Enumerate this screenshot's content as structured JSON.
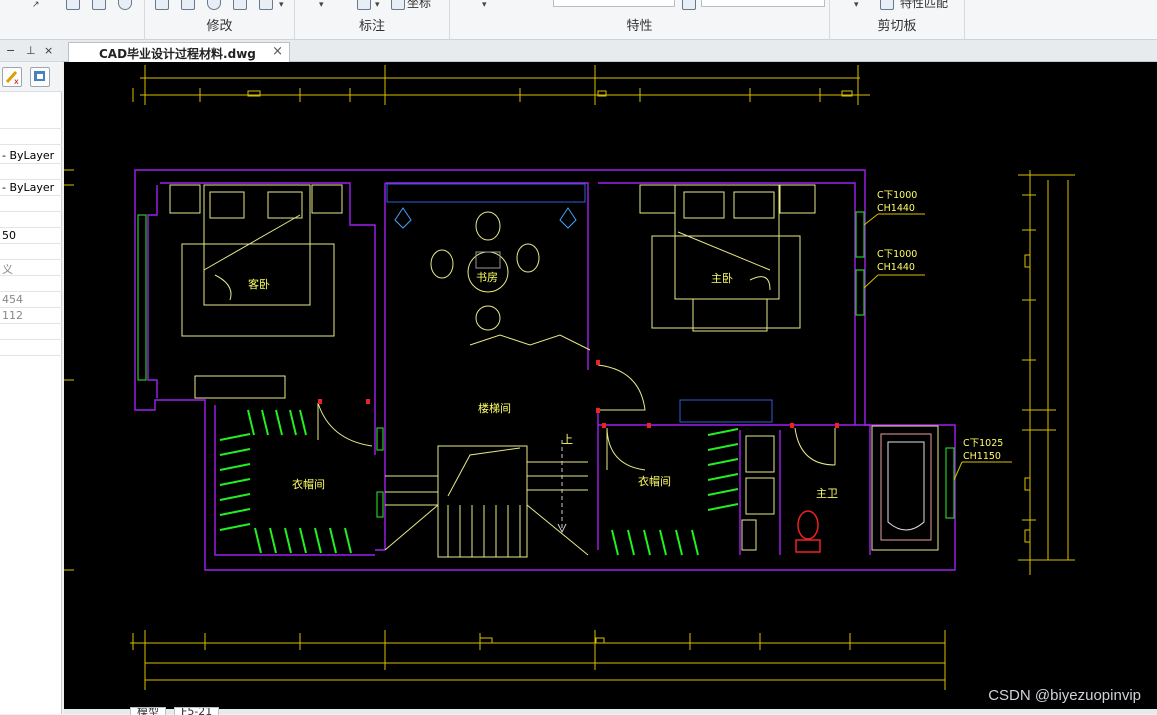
{
  "ribbon": {
    "groups": [
      {
        "label": "修改"
      },
      {
        "label": "标注"
      },
      {
        "label": "特性"
      },
      {
        "label": "剪切板"
      }
    ],
    "annotation_text": "坐标",
    "match_properties": "特性匹配"
  },
  "left_panel": {
    "rows": [
      {
        "value": "- ByLayer"
      },
      {
        "value": "- ByLayer"
      },
      {
        "value": "50"
      },
      {
        "value": "义"
      },
      {
        "value": "454"
      },
      {
        "value": "112"
      }
    ]
  },
  "document_tab": {
    "title": "CAD毕业设计过程材料.dwg",
    "close": "×"
  },
  "layout_tabs": [
    {
      "label": "模型"
    },
    {
      "label": "F5-21"
    }
  ],
  "drawing": {
    "rooms": {
      "guest_bedroom": "客卧",
      "study": "书房",
      "master_bedroom": "主卧",
      "stairwell": "楼梯间",
      "cloakroom_left": "衣帽间",
      "cloakroom_right": "衣帽间",
      "master_bath": "主卫",
      "stairs_up": "上"
    },
    "windows": [
      {
        "l1": "C下1000",
        "l2": "CH1440"
      },
      {
        "l1": "C下1000",
        "l2": "CH1440"
      },
      {
        "l1": "C下1025",
        "l2": "CH1150"
      }
    ]
  },
  "watermark": "CSDN @biyezuopinvip",
  "colors": {
    "canvas": "#000000",
    "wall": "#a020f0",
    "furniture": "#e8e888",
    "dimension": "#d8c000",
    "wardrobe": "#22ee22",
    "label": "#ffff66"
  }
}
